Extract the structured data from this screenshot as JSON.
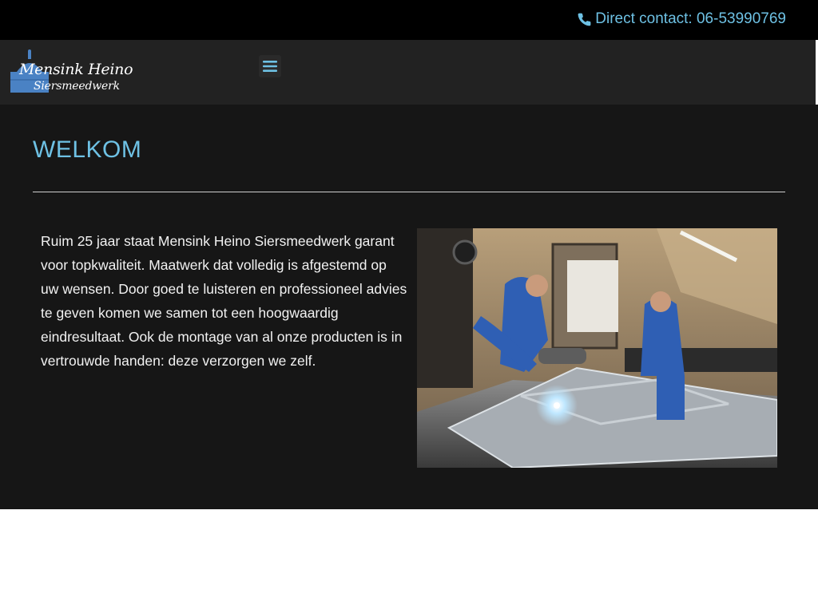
{
  "topbar": {
    "contact_label": "Direct contact: 06-53990769"
  },
  "header": {
    "logo_line1": "Mensink Heino",
    "logo_line2": "Siersmeedwerk",
    "menu_icon": "hamburger-menu-icon"
  },
  "main": {
    "title": "WELKOM",
    "intro_text": "Ruim 25 jaar staat Mensink Heino Siersmeedwerk garant voor topkwaliteit. Maatwerk dat volledig is afgestemd op uw wensen. Door goed te luisteren en professioneel advies te geven komen we samen tot een hoogwaardig eindresultaat. Ook de montage van al onze producten is in vertrouwde handen: deze verzorgen we zelf."
  },
  "icons": {
    "contact": "phone-icon",
    "menu": "hamburger-menu-icon"
  },
  "colors": {
    "accent": "#6ec1e4",
    "topbar_bg": "#000000",
    "header_bg": "#222222",
    "content_bg": "#161616",
    "logo_blue": "#4a82c4"
  }
}
